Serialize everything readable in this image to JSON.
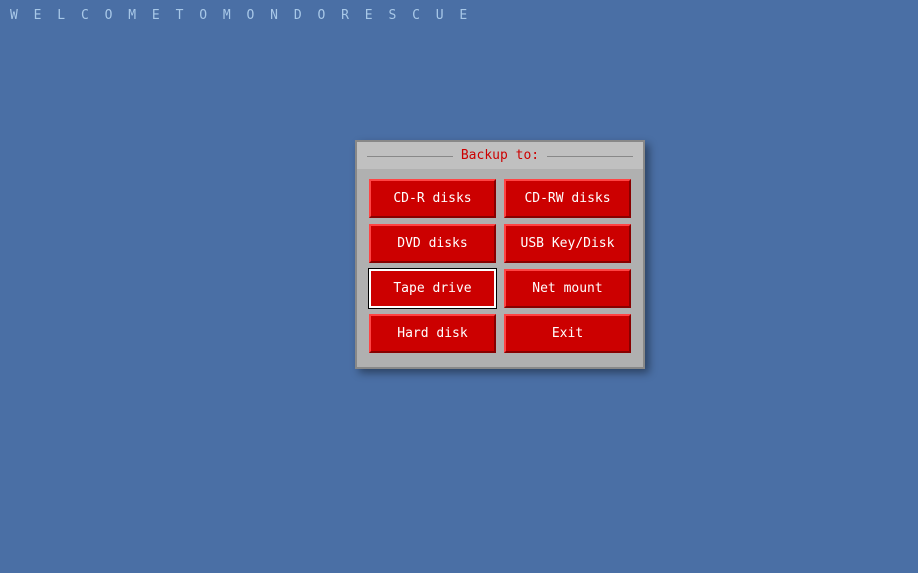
{
  "header": {
    "welcome_text": "W E L C O M E   T O   M O N D O   R E S C U E"
  },
  "dialog": {
    "title": "Backup to:",
    "buttons": [
      {
        "id": "cdr",
        "label": "CD-R disks",
        "focused": false
      },
      {
        "id": "cdrw",
        "label": "CD-RW disks",
        "focused": false
      },
      {
        "id": "dvd",
        "label": "DVD disks",
        "focused": false
      },
      {
        "id": "usb",
        "label": "USB Key/Disk",
        "focused": false
      },
      {
        "id": "tape",
        "label": "Tape drive",
        "focused": true
      },
      {
        "id": "net",
        "label": "Net mount",
        "focused": false
      },
      {
        "id": "hard",
        "label": "Hard disk",
        "focused": false
      },
      {
        "id": "exit",
        "label": "Exit",
        "focused": false
      }
    ]
  }
}
